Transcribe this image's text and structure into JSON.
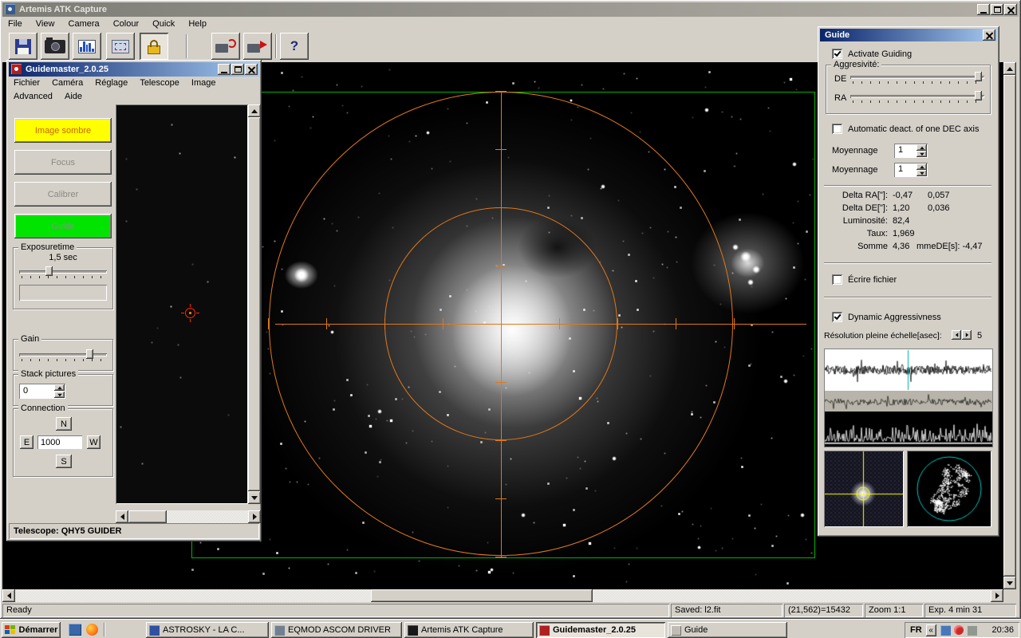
{
  "colors": {
    "title_active_dark": "#0a246a",
    "title_active_light": "#a6caf0",
    "window_gray": "#d4d0c8",
    "guide_button_green": "#00e400",
    "dark_button_yellow": "#ffff00",
    "reticle_orange": "#e07818",
    "frame_green": "#00b400",
    "scatter_cyan": "#00c8c8",
    "crosshair_yellow": "#ffff00",
    "marker_red": "#ff2800"
  },
  "artemis": {
    "title": "Artemis ATK Capture",
    "menu": [
      "File",
      "View",
      "Camera",
      "Colour",
      "Quick",
      "Help"
    ],
    "toolbar": {
      "help_glyph": "?"
    },
    "status": {
      "ready": "Ready",
      "saved": "Saved: l2.fit",
      "pixel_readout": "(21,562)=15432",
      "zoom": "Zoom 1:1",
      "exposure": "Exp. 4 min 31"
    }
  },
  "guidemaster": {
    "title": "Guidemaster_2.0.25",
    "menu_row1": [
      "Fichier",
      "Caméra",
      "Réglage",
      "Telescope",
      "Image"
    ],
    "menu_row2": [
      "Advanced",
      "Aide"
    ],
    "buttons": {
      "dark_frame": "Image sombre",
      "focus": "Focus",
      "calibrate": "Calibrer",
      "guide": "Guide"
    },
    "exposure_group": {
      "label": "Exposuretime",
      "value": "1,5 sec"
    },
    "gain_group": {
      "label": "Gain"
    },
    "stack_group": {
      "label": "Stack pictures",
      "value": "0"
    },
    "connection_group": {
      "label": "Connection",
      "north": "N",
      "east": "E",
      "south": "S",
      "west": "W",
      "rate_value": "1000"
    },
    "statusbar": "Telescope: QHY5 GUIDER"
  },
  "guide_panel": {
    "title": "Guide",
    "activate_guiding": "Activate Guiding",
    "aggressivity": {
      "label": "Aggresivité:",
      "de_label": "DE",
      "ra_label": "RA"
    },
    "auto_deact": "Automatic deact. of one DEC axis",
    "averaging_rows": [
      {
        "label": "Moyennage",
        "value": "1"
      },
      {
        "label": "Moyennage",
        "value": "1"
      }
    ],
    "stats": [
      {
        "label": "Delta RA[\"]:",
        "value": "-0,47",
        "extra": "0,057"
      },
      {
        "label": "Delta DE[\"]:",
        "value": "1,20",
        "extra": "0,036"
      },
      {
        "label": "Luminosité:",
        "value": "82,4",
        "extra": ""
      },
      {
        "label": "Taux:",
        "value": "1,969",
        "extra": ""
      },
      {
        "label": "Somme",
        "value": "4,36",
        "extra": "mmeDE[s]:  -4,47"
      }
    ],
    "write_file": "Écrire fichier",
    "dynamic_aggressivness": "Dynamic Aggressivness",
    "resolution": {
      "label": "Résolution pleine échelle[asec]:",
      "value": "5"
    }
  },
  "taskbar": {
    "start_label": "Démarrer",
    "tasks": [
      {
        "label": "ASTROSKY  -  LA C..."
      },
      {
        "label": "EQMOD ASCOM DRIVER"
      },
      {
        "label": "Artemis ATK Capture"
      },
      {
        "label": "Guidemaster_2.0.25"
      },
      {
        "label": "Guide"
      }
    ],
    "tray": {
      "language": "FR",
      "chevron": "«",
      "clock": "20:36"
    }
  }
}
